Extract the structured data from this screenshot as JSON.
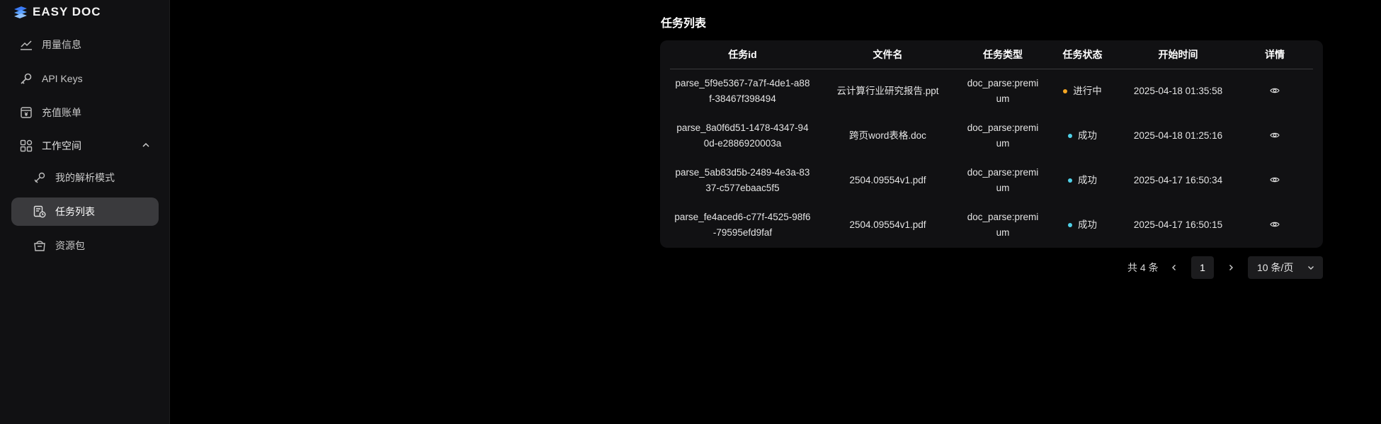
{
  "brand": {
    "name": "EASY DOC"
  },
  "sidebar": {
    "items": [
      {
        "label": "用量信息",
        "icon": "usage-chart-icon"
      },
      {
        "label": "API Keys",
        "icon": "key-icon"
      },
      {
        "label": "充值账单",
        "icon": "billing-icon"
      },
      {
        "label": "工作空间",
        "icon": "workspace-grid-icon",
        "expanded": true
      },
      {
        "label": "我的解析模式",
        "icon": "parse-mode-icon"
      },
      {
        "label": "任务列表",
        "icon": "task-list-icon",
        "active": true
      },
      {
        "label": "资源包",
        "icon": "resource-package-icon"
      }
    ]
  },
  "main": {
    "title": "任务列表",
    "table": {
      "headers": [
        "任务id",
        "文件名",
        "任务类型",
        "任务状态",
        "开始时间",
        "详情"
      ],
      "rows": [
        {
          "id": "parse_5f9e5367-7a7f-4de1-a88f-38467f398494",
          "file": "云计算行业研究报告.ppt",
          "type": "doc_parse:premium",
          "status": "进行中",
          "status_color": "#f5a623",
          "start": "2025-04-18 01:35:58"
        },
        {
          "id": "parse_8a0f6d51-1478-4347-940d-e2886920003a",
          "file": "跨页word表格.doc",
          "type": "doc_parse:premium",
          "status": "成功",
          "status_color": "#4fd1e8",
          "start": "2025-04-18 01:25:16"
        },
        {
          "id": "parse_5ab83d5b-2489-4e3a-8337-c577ebaac5f5",
          "file": "2504.09554v1.pdf",
          "type": "doc_parse:premium",
          "status": "成功",
          "status_color": "#4fd1e8",
          "start": "2025-04-17 16:50:34"
        },
        {
          "id": "parse_fe4aced6-c77f-4525-98f6-79595efd9faf",
          "file": "2504.09554v1.pdf",
          "type": "doc_parse:premium",
          "status": "成功",
          "status_color": "#4fd1e8",
          "start": "2025-04-17 16:50:15"
        }
      ]
    },
    "pagination": {
      "total_text": "共 4 条",
      "current_page": "1",
      "page_size": "10 条/页"
    }
  }
}
